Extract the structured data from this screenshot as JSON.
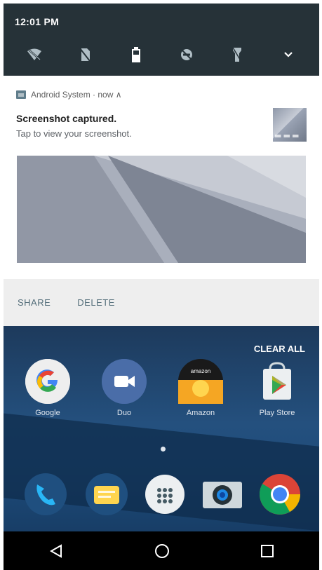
{
  "status_bar": {
    "time": "12:01 PM",
    "quick_settings": [
      {
        "icon": "wifi-off-icon"
      },
      {
        "icon": "no-sim-icon"
      },
      {
        "icon": "battery-icon"
      },
      {
        "icon": "do-not-disturb-icon"
      },
      {
        "icon": "flashlight-icon"
      },
      {
        "icon": "chevron-down-icon"
      }
    ]
  },
  "notification": {
    "header": "Android System · now ∧",
    "title": "Screenshot captured.",
    "text": "Tap to view your screenshot."
  },
  "actions": {
    "share": "SHARE",
    "delete": "DELETE"
  },
  "home": {
    "clear_all": "CLEAR ALL",
    "apps": [
      {
        "label": "Google"
      },
      {
        "label": "Duo"
      },
      {
        "label": "Amazon"
      },
      {
        "label": "Play Store"
      }
    ],
    "amazon_text": "amazon",
    "dock_icons": [
      "phone-icon",
      "messages-icon",
      "app-drawer-icon",
      "camera-icon",
      "chrome-icon"
    ]
  },
  "nav": [
    "back-icon",
    "home-icon",
    "recents-icon"
  ]
}
